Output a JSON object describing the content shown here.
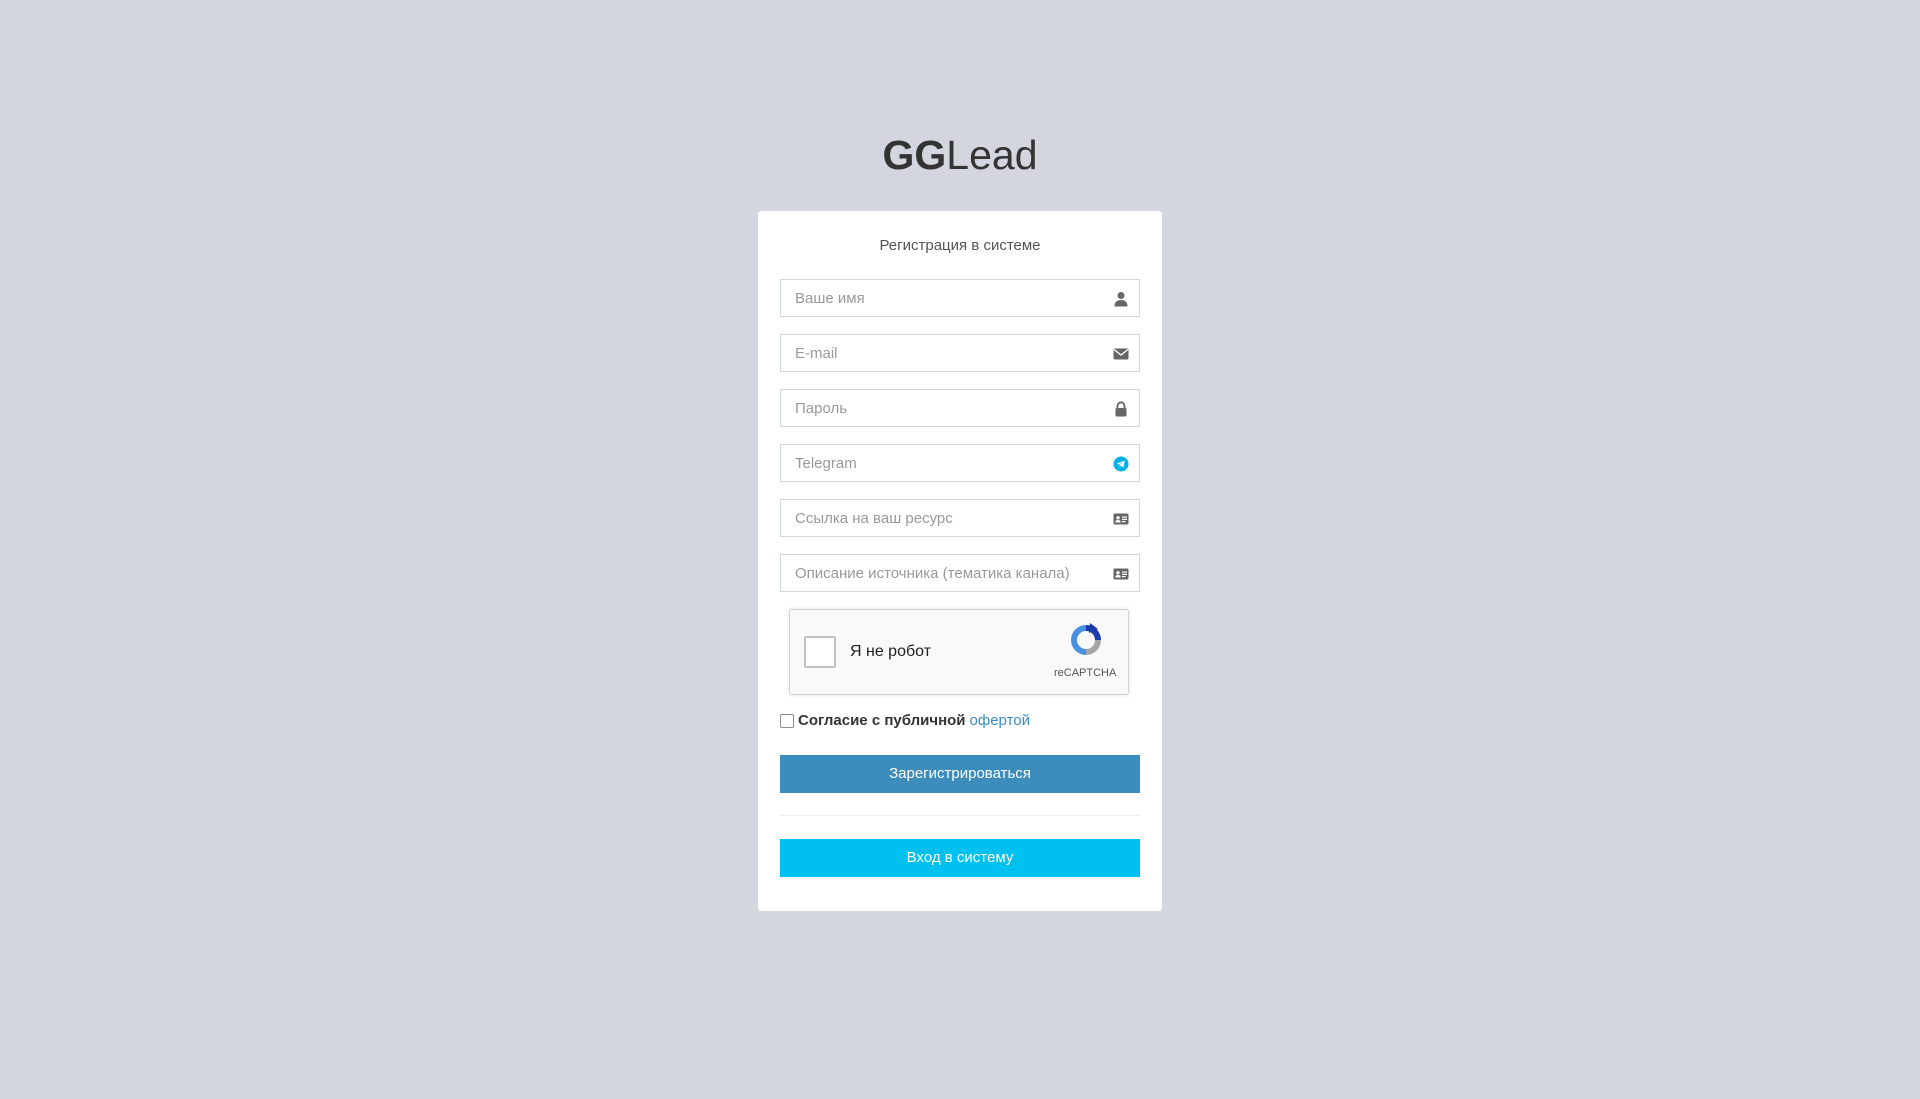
{
  "brand": {
    "bold": "GG",
    "light": "Lead"
  },
  "form": {
    "title": "Регистрация в системе",
    "fields": {
      "name": {
        "placeholder": "Ваше имя",
        "icon": "user-icon"
      },
      "email": {
        "placeholder": "E-mail",
        "icon": "envelope-icon"
      },
      "password": {
        "placeholder": "Пароль",
        "icon": "lock-icon"
      },
      "telegram": {
        "placeholder": "Telegram",
        "icon": "telegram-icon"
      },
      "resource": {
        "placeholder": "Ссылка на ваш ресурс",
        "icon": "id-card-icon"
      },
      "description": {
        "placeholder": "Описание источника (тематика канала)",
        "icon": "id-card-icon"
      }
    },
    "captcha": {
      "label": "Я не робот",
      "brand": "reCAPTCHA"
    },
    "agreement": {
      "text": "Согласие с публичной",
      "link": "офертой"
    },
    "register_button": "Зарегистрироваться",
    "login_button": "Вход в систему"
  },
  "colors": {
    "background": "#d3d6df",
    "primary": "#3c8dbc",
    "info": "#00c0ef",
    "telegram": "#2aabee"
  }
}
